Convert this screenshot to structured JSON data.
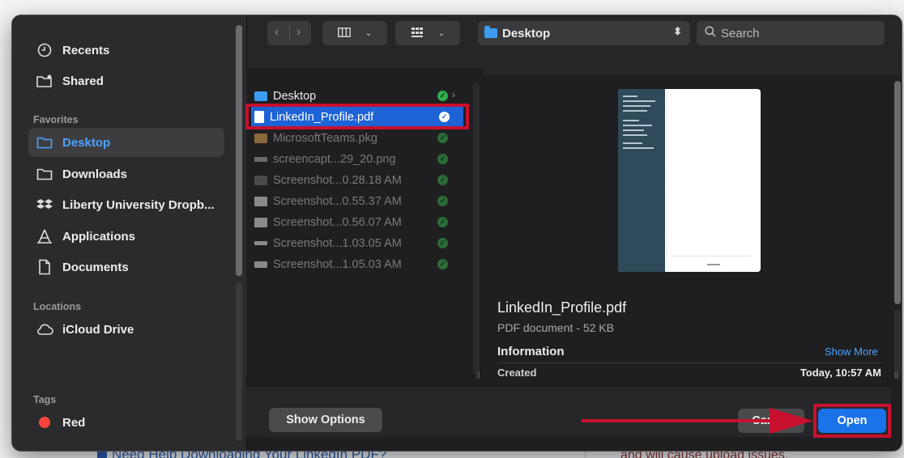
{
  "sidebar": {
    "top_items": [
      {
        "label": "Recents",
        "icon": "clock-icon"
      },
      {
        "label": "Shared",
        "icon": "shared-folder-icon"
      }
    ],
    "favorites_header": "Favorites",
    "favorites": [
      {
        "label": "Desktop",
        "icon": "folder-icon",
        "active": true
      },
      {
        "label": "Downloads",
        "icon": "folder-icon"
      },
      {
        "label": "Liberty University Dropb...",
        "icon": "dropbox-icon"
      },
      {
        "label": "Applications",
        "icon": "applications-icon"
      },
      {
        "label": "Documents",
        "icon": "document-icon"
      }
    ],
    "locations_header": "Locations",
    "locations": [
      {
        "label": "iCloud Drive",
        "icon": "cloud-icon"
      }
    ],
    "tags_header": "Tags",
    "tags": [
      {
        "label": "Red",
        "color": "#ff453a"
      }
    ]
  },
  "toolbar": {
    "location": "Desktop",
    "search_placeholder": "Search"
  },
  "files": [
    {
      "name": "Desktop",
      "type": "folder",
      "dim": false
    },
    {
      "name": "LinkedIn_Profile.pdf",
      "type": "pdf",
      "selected": true
    },
    {
      "name": "MicrosoftTeams.pkg",
      "type": "pkg",
      "dim": true
    },
    {
      "name": "screencapt...29_20.png",
      "type": "image",
      "dim": true
    },
    {
      "name": "Screenshot...0.28.18 AM",
      "type": "image",
      "dim": true
    },
    {
      "name": "Screenshot...0.55.37 AM",
      "type": "image",
      "dim": true
    },
    {
      "name": "Screenshot...0.56.07 AM",
      "type": "image",
      "dim": true
    },
    {
      "name": "Screenshot...1.03.05 AM",
      "type": "image",
      "dim": true
    },
    {
      "name": "Screenshot...1.05.03 AM",
      "type": "image",
      "dim": true
    }
  ],
  "preview": {
    "name": "LinkedIn_Profile.pdf",
    "kind": "PDF document - 52 KB",
    "info_label": "Information",
    "show_more": "Show More",
    "created_label": "Created",
    "created_value": "Today, 10:57 AM"
  },
  "buttons": {
    "show_options": "Show Options",
    "cancel": "Cancel",
    "open": "Open"
  },
  "background": {
    "left_text": "Need Help Downloading Your LinkedIn PDF?",
    "right_text": "and will cause upload issues."
  },
  "colors": {
    "accent": "#1a73e8",
    "highlight": "#c8102e",
    "selected_row": "#1d63d6"
  }
}
